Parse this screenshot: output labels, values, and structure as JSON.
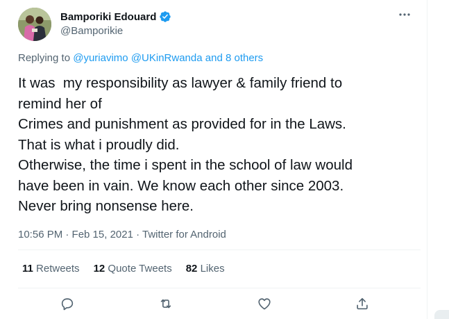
{
  "tweet": {
    "author": {
      "display_name": "Bamporiki Edouard",
      "handle": "@Bamporikie",
      "verified": true
    },
    "more_icon": "more-horizontal-icon",
    "replying_prefix": "Replying to ",
    "replying_to": [
      "@yuriavimo",
      "@UKinRwanda"
    ],
    "replying_and": " and ",
    "replying_others": "8 others",
    "lines": [
      "It was  my responsibility as lawyer & family friend to",
      "remind her of",
      "Crimes and punishment as provided for in the Laws.",
      "That is what i proudly did.",
      "Otherwise, the time i spent in the school of law would",
      "have been in vain. We know each other since 2003.",
      "Never bring nonsense here."
    ],
    "timestamp": "10:56 PM · Feb 15, 2021 · Twitter for Android",
    "stats": {
      "retweets": {
        "count": "11",
        "label": "Retweets"
      },
      "quote_tweets": {
        "count": "12",
        "label": "Quote Tweets"
      },
      "likes": {
        "count": "82",
        "label": "Likes"
      }
    },
    "actions": [
      "reply-icon",
      "retweet-icon",
      "like-icon",
      "share-icon"
    ]
  },
  "colors": {
    "text_primary": "#0f1419",
    "text_secondary": "#536471",
    "link": "#1d9bf0",
    "divider": "#eff3f4",
    "verified": "#1d9bf0"
  }
}
